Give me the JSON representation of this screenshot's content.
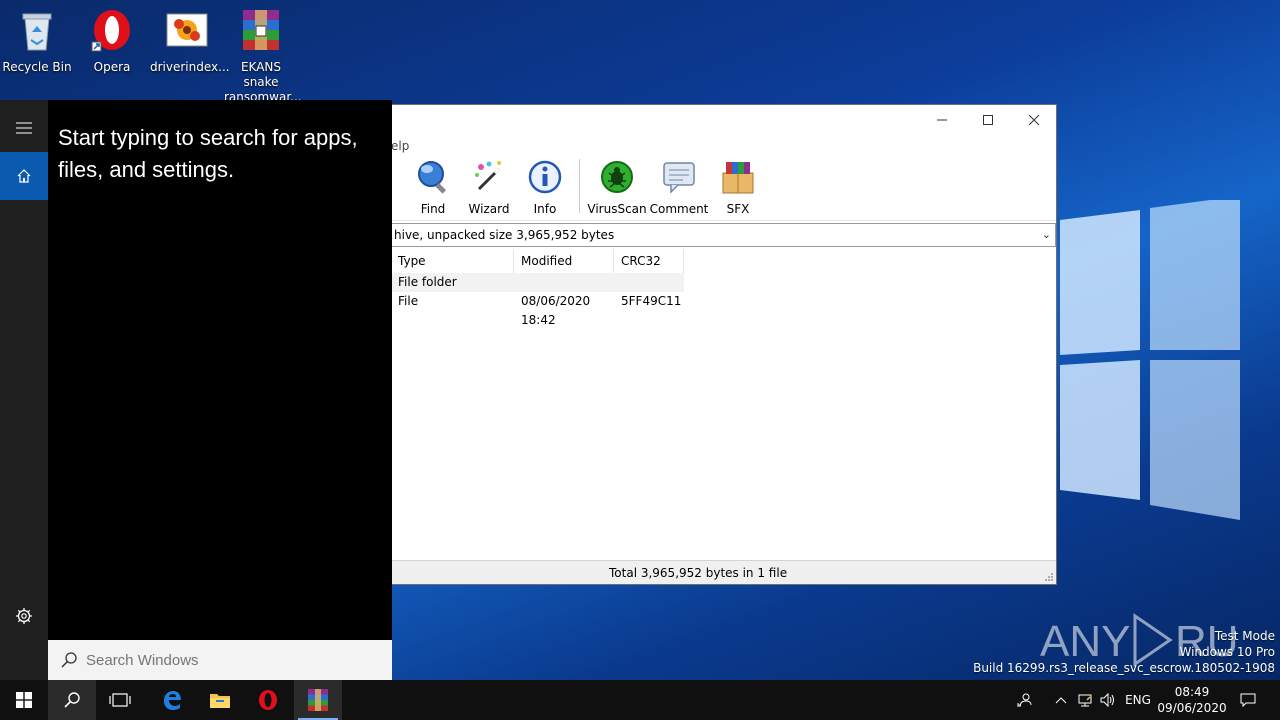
{
  "desktop": {
    "icons": [
      {
        "label": "Recycle Bin",
        "icon": "recycle-bin-icon"
      },
      {
        "label": "Opera",
        "icon": "opera-icon"
      },
      {
        "label": "driverindex...",
        "icon": "image-file-icon"
      },
      {
        "label": "EKANS snake ransomwar...",
        "icon": "winrar-archive-icon"
      }
    ],
    "watermark": {
      "line1": "Test Mode",
      "line2": "Windows 10 Pro",
      "line3": "Build 16299.rs3_release_svc_escrow.180502-1908"
    }
  },
  "rar_window": {
    "menu_visible": "Help",
    "menu_partial": "elp",
    "toolbar": [
      {
        "label": "Find",
        "icon": "find-icon"
      },
      {
        "label": "Wizard",
        "icon": "wizard-icon"
      },
      {
        "label": "Info",
        "icon": "info-icon"
      },
      {
        "label": "VirusScan",
        "icon": "virusscan-icon"
      },
      {
        "label": "Comment",
        "icon": "comment-icon"
      },
      {
        "label": "SFX",
        "icon": "sfx-icon"
      }
    ],
    "address_text": "hive, unpacked size 3,965,952 bytes",
    "columns": [
      "Type",
      "Modified",
      "CRC32"
    ],
    "rows": [
      {
        "type": "File folder",
        "modified": "",
        "crc": ""
      },
      {
        "type": "File",
        "modified": "08/06/2020 18:42",
        "crc": "5FF49C11"
      }
    ],
    "status": "Total 3,965,952 bytes in 1 file"
  },
  "start_menu": {
    "message": "Start typing to search for apps, files, and settings.",
    "search_placeholder": "Search Windows"
  },
  "taskbar": {
    "lang": "ENG",
    "time": "08:49",
    "date": "09/06/2020"
  },
  "colors": {
    "accent": "#0a5bb0",
    "taskbar": "#101010",
    "start_bg": "#000000"
  }
}
